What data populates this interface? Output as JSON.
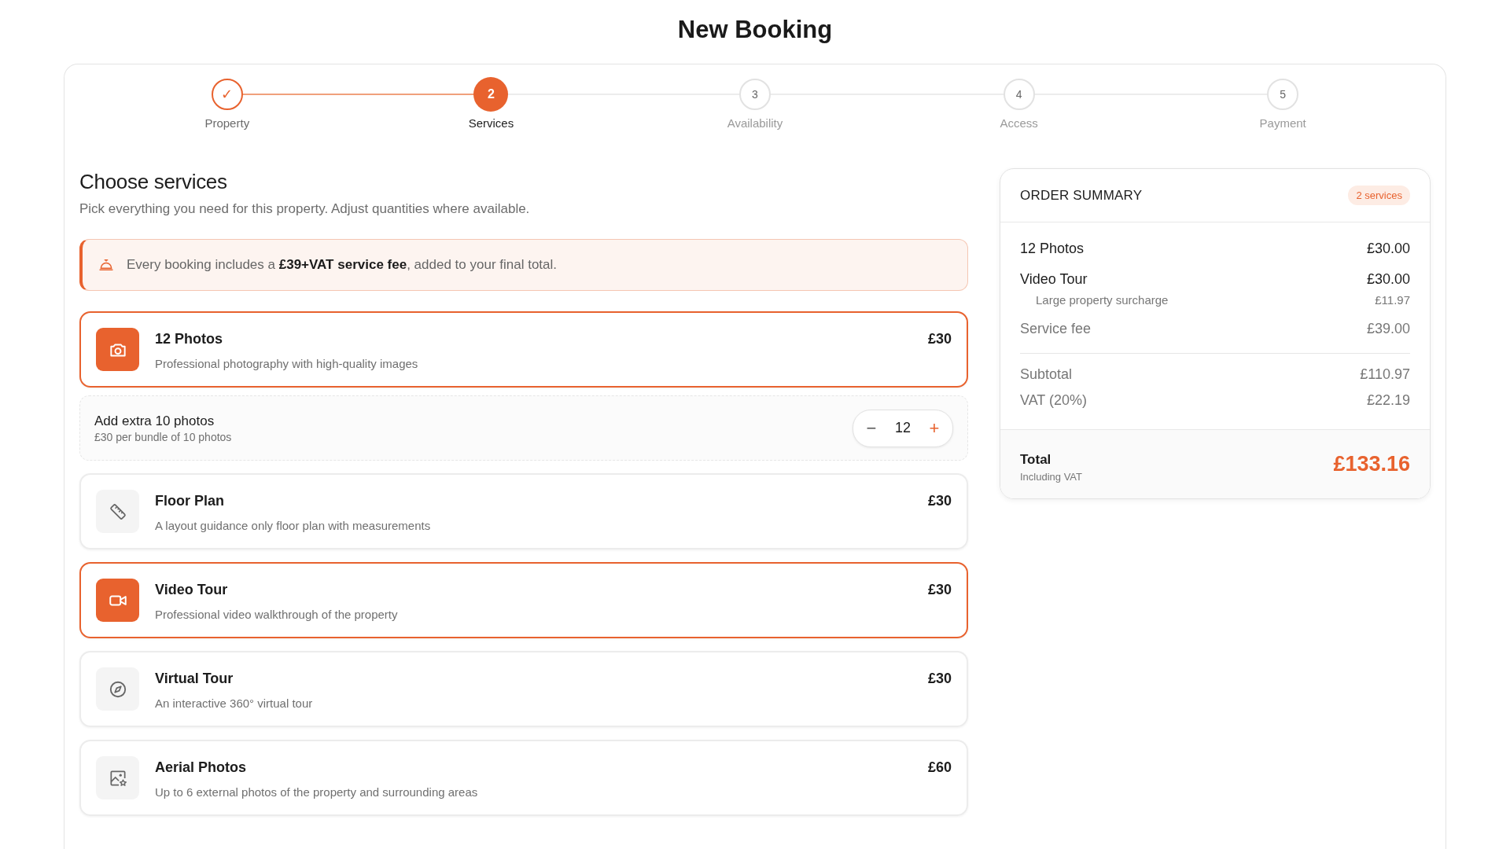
{
  "page": {
    "title": "New Booking"
  },
  "steps": [
    {
      "marker": "✓",
      "label": "Property",
      "completed": true,
      "selected": false
    },
    {
      "marker": "2",
      "label": "Services",
      "completed": false,
      "selected": true
    },
    {
      "marker": "3",
      "label": "Availability",
      "completed": false,
      "selected": false
    },
    {
      "marker": "4",
      "label": "Access",
      "completed": false,
      "selected": false
    },
    {
      "marker": "5",
      "label": "Payment",
      "completed": false,
      "selected": false
    }
  ],
  "services_section": {
    "heading": "Choose services",
    "subtitle": "Pick everything you need for this property. Adjust quantities where available.",
    "notice": "Every booking includes a **£39+VAT service fee**, added to your final total.",
    "items": [
      {
        "kind": "service",
        "title": "12 Photos",
        "description": "Professional photography with high-quality images",
        "price": "£30",
        "selected": true
      },
      {
        "kind": "addon",
        "title": "Add extra 10 photos",
        "description": "£30 per bundle of 10 photos",
        "quantity": "12",
        "minus": "−",
        "plus": "+"
      },
      {
        "kind": "service",
        "title": "Floor Plan",
        "description": "A layout guidance only floor plan with measurements",
        "price": "£30",
        "selected": false
      },
      {
        "kind": "service",
        "title": "Video Tour",
        "description": "Professional video walkthrough of the property",
        "price": "£30",
        "selected": true
      },
      {
        "kind": "service",
        "title": "Virtual Tour",
        "description": "An interactive 360° virtual tour",
        "price": "£30",
        "selected": false
      },
      {
        "kind": "service",
        "title": "Aerial Photos",
        "description": "Up to 6 external photos of the property and surrounding areas",
        "price": "£60",
        "selected": false
      }
    ]
  },
  "order_summary": {
    "title": "ORDER SUMMARY",
    "badge": "2 services",
    "lines": [
      {
        "kind": "item",
        "label": "12 Photos",
        "amount": "£30.00"
      },
      {
        "kind": "item",
        "label": "Video Tour",
        "amount": "£30.00"
      },
      {
        "kind": "sub",
        "label": "Large property surcharge",
        "amount": "£11.97"
      },
      {
        "kind": "fee",
        "label": "Service fee",
        "amount": "£39.00"
      }
    ],
    "totals": [
      {
        "label": "Subtotal",
        "amount": "£110.97"
      },
      {
        "label": "VAT (20%)",
        "amount": "£22.19"
      }
    ],
    "total": {
      "label": "Total",
      "note": "Including VAT",
      "amount": "£133.16"
    }
  }
}
